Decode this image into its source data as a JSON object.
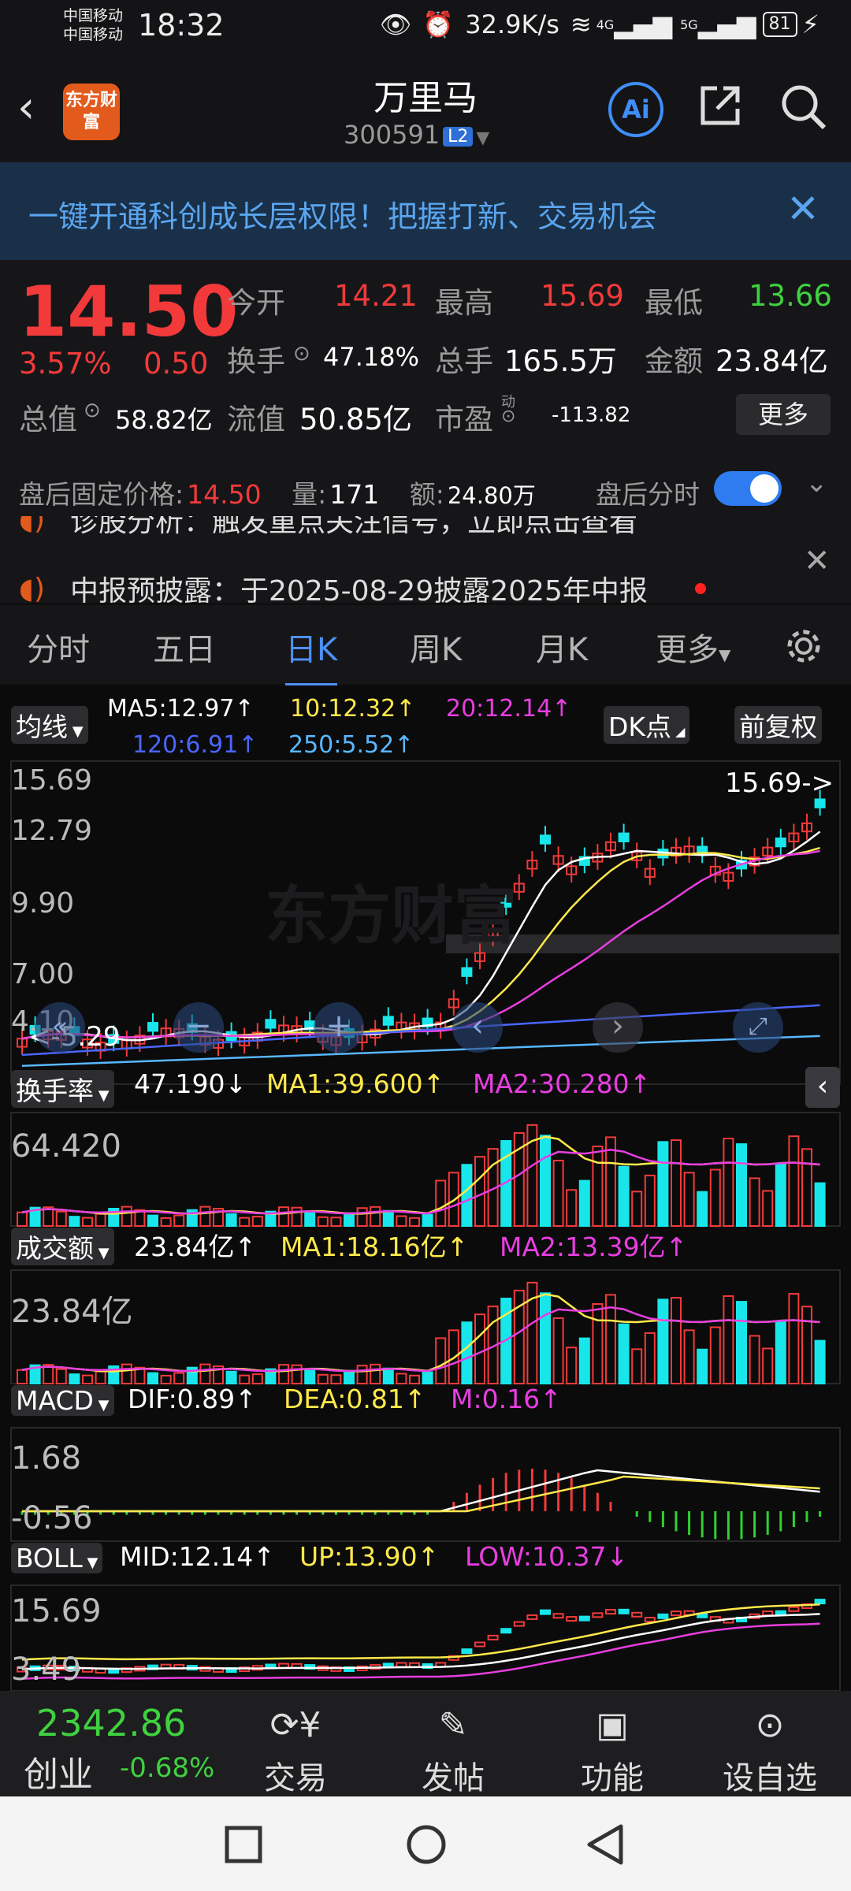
{
  "status": {
    "carrier1": "中国移动",
    "carrier2": "中国移动",
    "time": "18:32",
    "net_speed": "32.9K/s",
    "signal1": "4G",
    "signal2": "5G",
    "battery": "81"
  },
  "header": {
    "logo_text": "东方财富",
    "title": "万里马",
    "code": "300591",
    "level": "L2",
    "ai_label": "Ai"
  },
  "banner": {
    "text": "一键开通科创成长层权限！把握打新、交易机会"
  },
  "quote": {
    "price": "14.50",
    "change_pct": "3.57%",
    "change": "0.50",
    "open_label": "今开",
    "open": "14.21",
    "high_label": "最高",
    "high": "15.69",
    "low_label": "最低",
    "low": "13.66",
    "turnover_label": "换手",
    "turnover": "47.18%",
    "volume_label": "总手",
    "volume": "165.5万",
    "amount_label": "金额",
    "amount": "23.84亿",
    "mcap_label": "总值",
    "mcap": "58.82亿",
    "float_label": "流值",
    "float": "50.85亿",
    "pe_label": "市盈",
    "pe_sup": "动",
    "pe": "-113.82",
    "more": "更多"
  },
  "after_hours": {
    "price_label": "盘后固定价格:",
    "price": "14.50",
    "vol_label": "量:",
    "vol": "171",
    "amt_label": "额:",
    "amt": "24.80万",
    "time_label": "盘后分时"
  },
  "notices": [
    {
      "text": "诊股分析：触发重点关注信号，立即点击查看"
    },
    {
      "text": "中报预披露：于2025-08-29披露2025年中报"
    }
  ],
  "tabs": [
    "分时",
    "五日",
    "日K",
    "周K",
    "月K",
    "更多"
  ],
  "chart": {
    "ma_selector": "均线",
    "ma5": "MA5:12.97↑",
    "ma10": "10:12.32↑",
    "ma20": "20:12.14↑",
    "ma120": "120:6.91↑",
    "ma250": "250:5.52↑",
    "dk_label": "DK点",
    "adjust_label": "前复权",
    "y_labels": [
      "15.69",
      "12.79",
      "9.90",
      "7.00",
      "4.10"
    ],
    "high_marker": "15.69->",
    "low_marker": "5.29",
    "turnover_selector": "换手率",
    "turnover_val": "47.190↓",
    "turnover_ma1": "MA1:39.600↑",
    "turnover_ma2": "MA2:30.280↑",
    "turnover_y": "64.420",
    "amount_selector": "成交额",
    "amount_val": "23.84亿↑",
    "amount_ma1": "MA1:18.16亿↑",
    "amount_ma2": "MA2:13.39亿↑",
    "amount_y": "23.84亿",
    "macd_selector": "MACD",
    "dif": "DIF:0.89↑",
    "dea": "DEA:0.81↑",
    "m": "M:0.16↑",
    "macd_y1": "1.68",
    "macd_y2": "-0.56",
    "boll_selector": "BOLL",
    "mid": "MID:12.14↑",
    "up": "UP:13.90↑",
    "low": "LOW:10.37↓",
    "boll_y1": "15.69",
    "boll_y2": "3.49",
    "watermark": "东方财富",
    "colors": {
      "up": "#f23a3a",
      "down": "#18e6ea",
      "ma5": "#ffffff",
      "ma10": "#ffe94a",
      "ma20": "#e83ee0",
      "ma120": "#4a66ff",
      "ma250": "#58b8ff"
    }
  },
  "bottom": {
    "index_value": "2342.86",
    "index_name": "创业",
    "index_change": "-0.68%",
    "items": [
      "交易",
      "发帖",
      "功能",
      "设自选"
    ]
  }
}
